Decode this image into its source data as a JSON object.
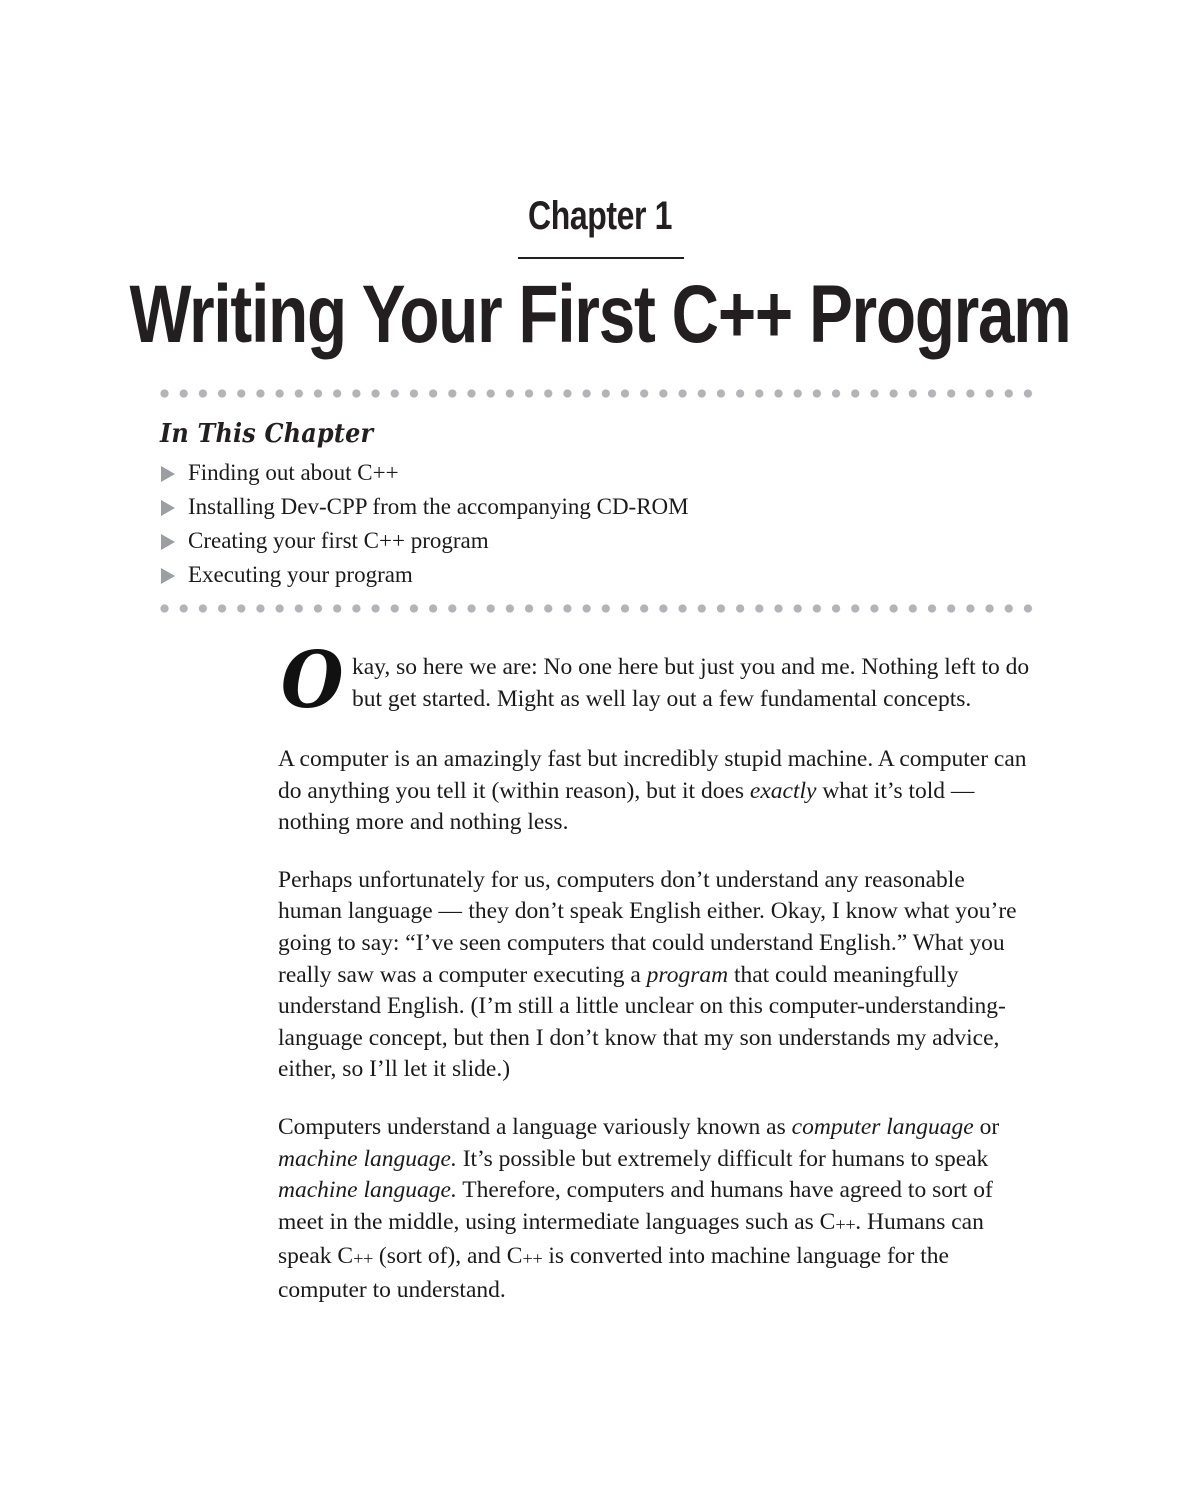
{
  "page": {
    "background_color": "#ffffff",
    "text_color": "#1a1a1a"
  },
  "chapter": {
    "label": "Chapter 1",
    "title": "Writing Your First C++ Program"
  },
  "in_this_chapter": {
    "heading": "In This Chapter",
    "bullet_color": "#9d9ea2",
    "rule_dot_color": "#b3b4b8",
    "items": [
      {
        "text": "Finding out about C++"
      },
      {
        "text": "Installing Dev-CPP from the accompanying CD-ROM"
      },
      {
        "text": "Creating your first C++ program"
      },
      {
        "text": "Executing your program"
      }
    ]
  },
  "body": {
    "paragraphs": [
      {
        "dropcap": "O",
        "text": "kay, so here we are: No one here but just you and me. Nothing left to do but get started. Might as well lay out a few fundamental concepts."
      },
      {
        "text": "A computer is an amazingly fast but incredibly stupid machine. A computer can do anything you tell it (within reason), but it does exactly what it’s told — nothing more and nothing less."
      },
      {
        "text": "Perhaps unfortunately for us, computers don’t understand any reasonable human language — they don’t speak English either. Okay, I know what you’re going to say: “I’ve seen computers that could understand English.” What you really saw was a computer executing a program that could meaningfully understand English. (I’m still a little unclear on this computer-understanding-language concept, but then I don’t know that my son understands my advice, either, so I’ll let it slide.)"
      },
      {
        "text": "Computers understand a language variously known as computer language or machine language. It’s possible but extremely difficult for humans to speak machine language. Therefore, computers and humans have agreed to sort of meet in the middle, using intermediate languages such as C++. Humans can speak C++ (sort of), and C++ is converted into machine language for the computer to understand."
      }
    ]
  }
}
